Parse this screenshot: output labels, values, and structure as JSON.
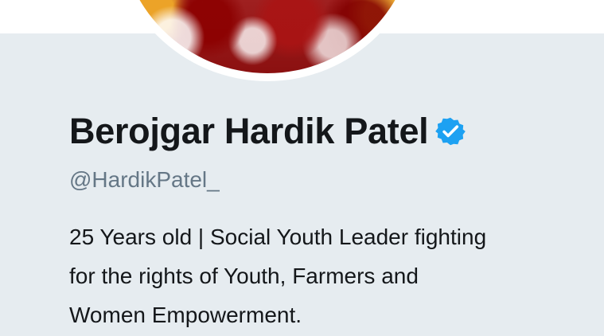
{
  "profile": {
    "display_name": "Berojgar Hardik Patel",
    "handle": "@HardikPatel_",
    "bio": "25 Years old | Social Youth Leader fighting\nfor the rights of Youth, Farmers and\nWomen Empowerment.",
    "verified_icon": "verified-badge-icon",
    "avatar_icon": "profile-avatar"
  },
  "theme": {
    "background": "#e6ecf0",
    "panel": "#ffffff",
    "text_primary": "#14171a",
    "text_secondary": "#657786",
    "verified_badge": "#1da1f2"
  }
}
